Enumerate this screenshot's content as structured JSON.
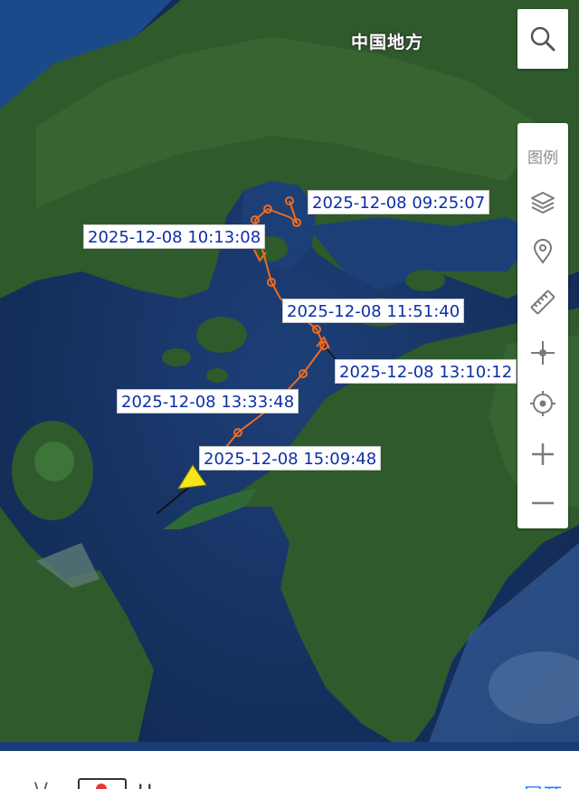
{
  "map": {
    "region_label": "中国地方",
    "track_points": [
      {
        "time": "2025-12-08 09:25:07"
      },
      {
        "time": "2025-12-08 10:13:08"
      },
      {
        "time": "2025-12-08 11:51:40"
      },
      {
        "time": "2025-12-08 13:10:12"
      },
      {
        "time": "2025-12-08 13:33:48"
      },
      {
        "time": "2025-12-08 15:09:48"
      }
    ],
    "colors": {
      "track": "#f26a1e",
      "vessel_marker": "#f7e51c",
      "label_text": "#0d2fa8",
      "sea": "#16305c",
      "land": "#2e5a2c"
    }
  },
  "toolbar": {
    "search_icon": "search-icon",
    "legend_label": "图例",
    "tools": [
      "layers-icon",
      "location-pin-icon",
      "ruler-icon",
      "center-crosshair-icon",
      "locate-target-icon",
      "zoom-in-icon",
      "zoom-out-icon"
    ]
  },
  "bottom": {
    "left_glyph": "\\/",
    "name": "H",
    "expand_label": "展开"
  }
}
